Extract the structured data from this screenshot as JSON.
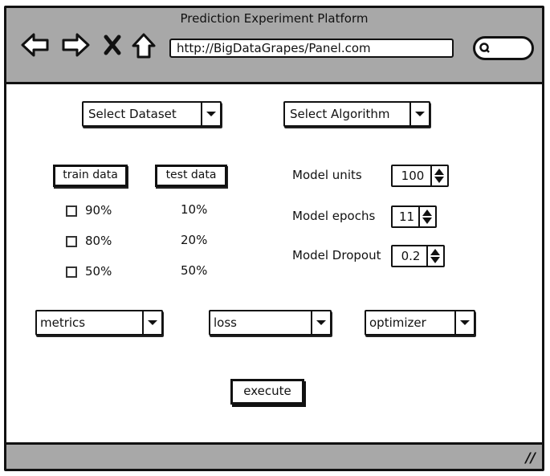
{
  "window": {
    "title": "Prediction Experiment Platform"
  },
  "browser": {
    "url": "http://BigDataGrapes/Panel.com",
    "icons": [
      "back-arrow-icon",
      "forward-arrow-icon",
      "stop-icon",
      "home-icon",
      "search-icon"
    ]
  },
  "selectors": {
    "dataset": "Select  Dataset",
    "algorithm": "Select  Algorithm"
  },
  "split": {
    "train_label": "train data",
    "test_label": "test data",
    "options": [
      {
        "train": "90%",
        "test": "10%",
        "checked": false
      },
      {
        "train": "80%",
        "test": "20%",
        "checked": false
      },
      {
        "train": "50%",
        "test": "50%",
        "checked": false
      }
    ]
  },
  "model": {
    "units_label": "Model units",
    "units_value": "100",
    "epochs_label": "Model epochs",
    "epochs_value": "11",
    "dropout_label": "Model Dropout",
    "dropout_value": "0.2"
  },
  "dropdowns": {
    "metrics": "metrics",
    "loss": "loss",
    "optimizer": "optimizer"
  },
  "actions": {
    "execute": "execute"
  },
  "colors": {
    "chrome": "#a8a8a8",
    "ink": "#111111",
    "canvas": "#ffffff"
  }
}
